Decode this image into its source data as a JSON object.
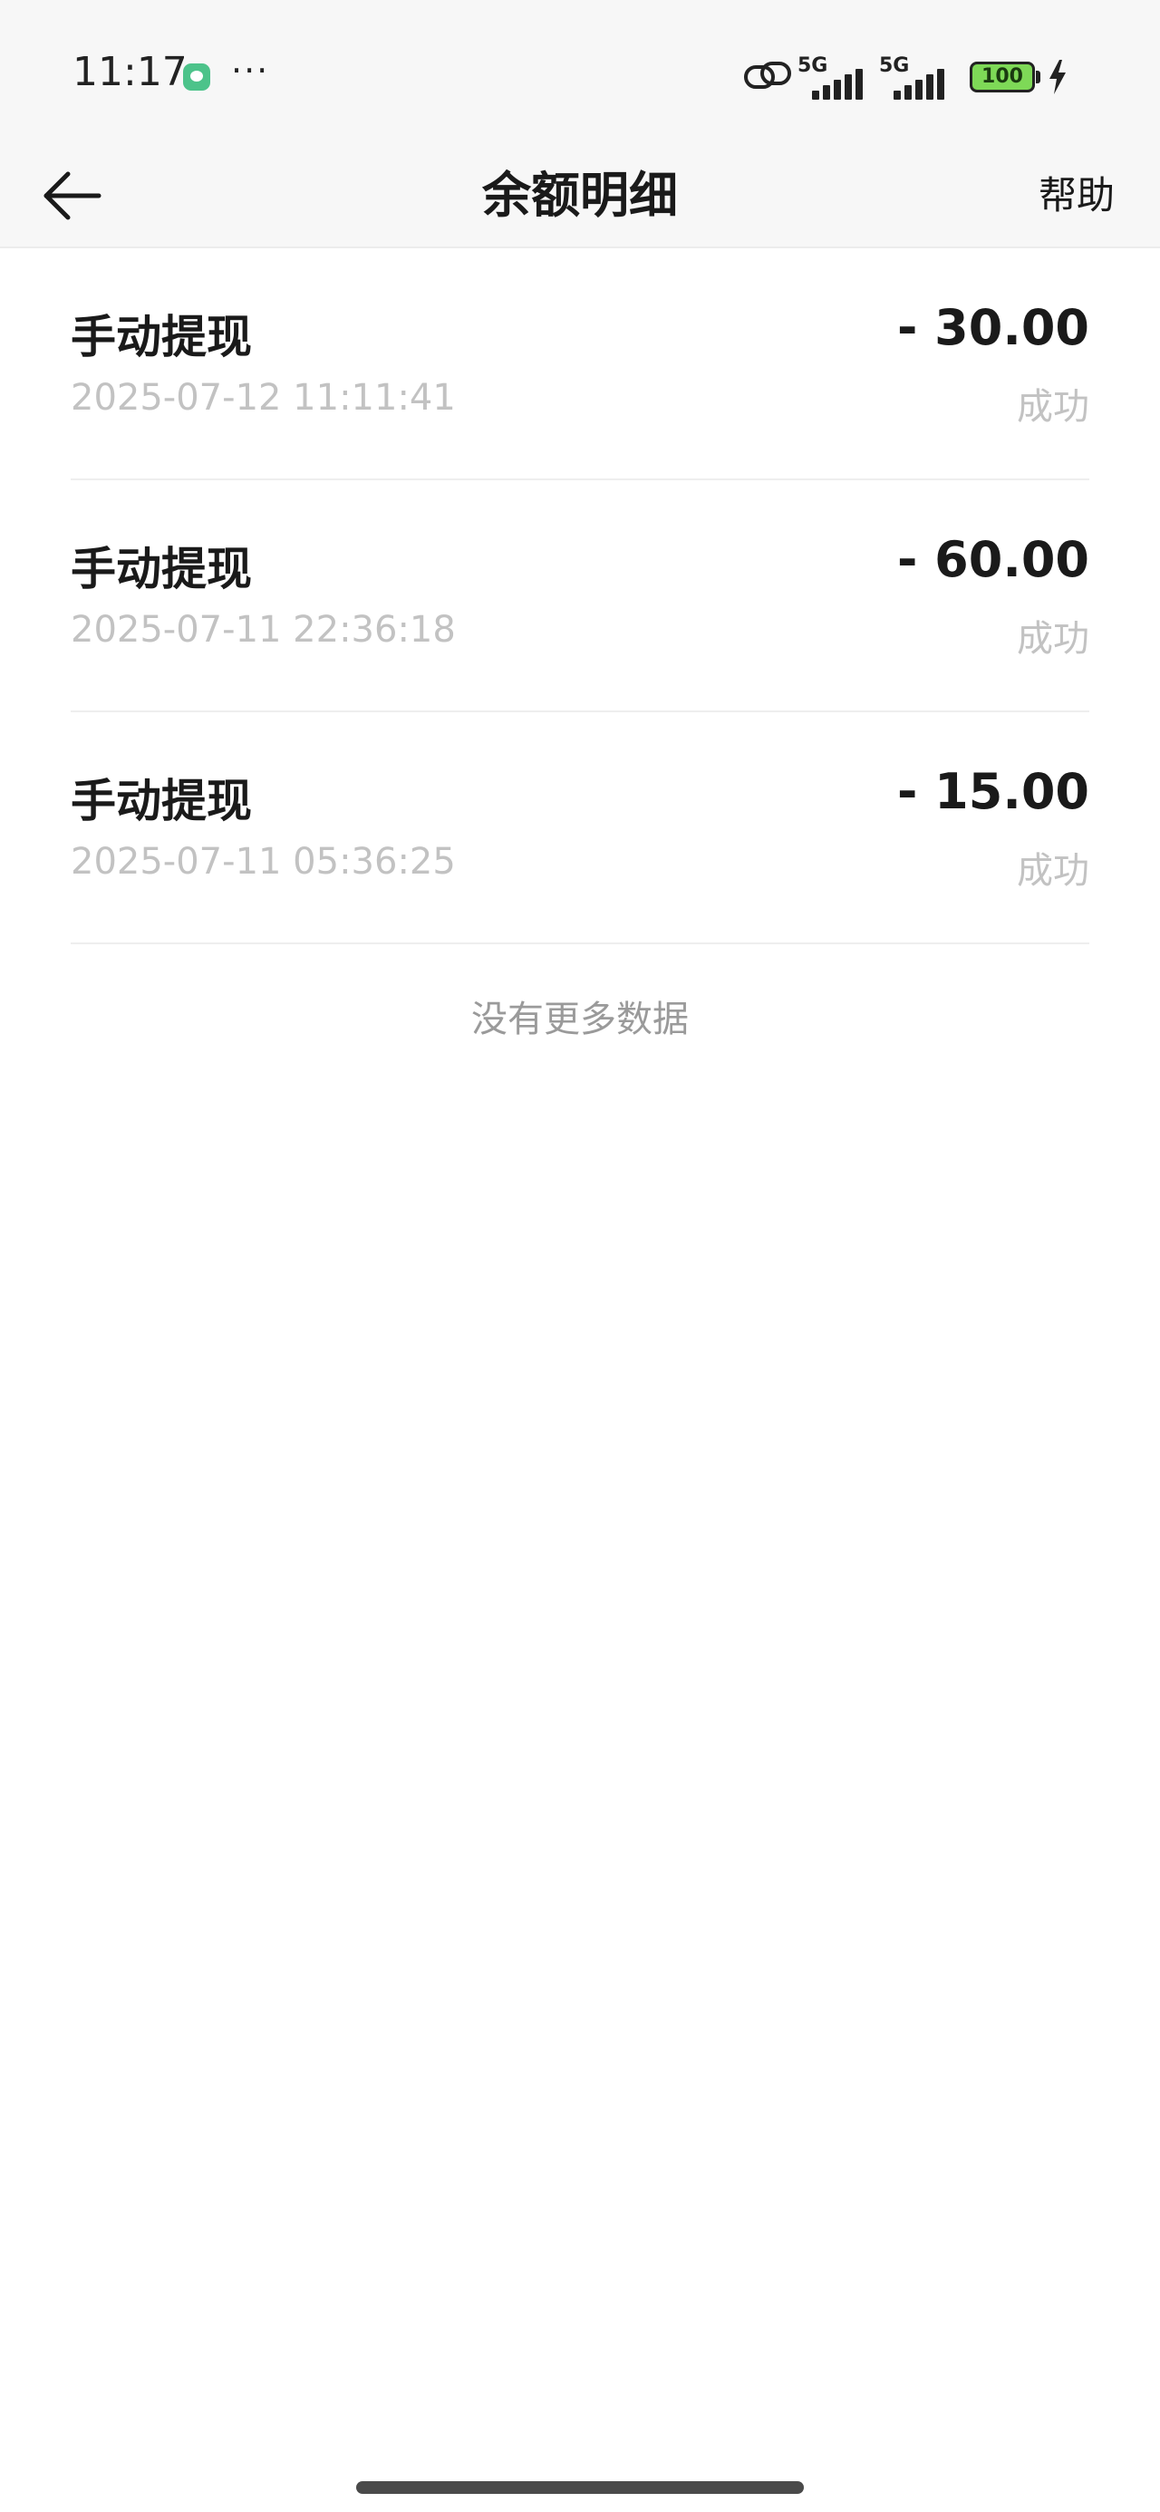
{
  "status_bar": {
    "time": "11:17",
    "more": "···",
    "sim1_label": "5G",
    "sim2_label": "5G",
    "battery": "100"
  },
  "header": {
    "title": "余额明细",
    "help": "帮助"
  },
  "transactions": [
    {
      "title": "手动提现",
      "time": "2025-07-12 11:11:41",
      "amount": "- 30.00",
      "status": "成功"
    },
    {
      "title": "手动提现",
      "time": "2025-07-11 22:36:18",
      "amount": "- 60.00",
      "status": "成功"
    },
    {
      "title": "手动提现",
      "time": "2025-07-11 05:36:25",
      "amount": "- 15.00",
      "status": "成功"
    }
  ],
  "footer": {
    "no_more": "没有更多数据"
  }
}
